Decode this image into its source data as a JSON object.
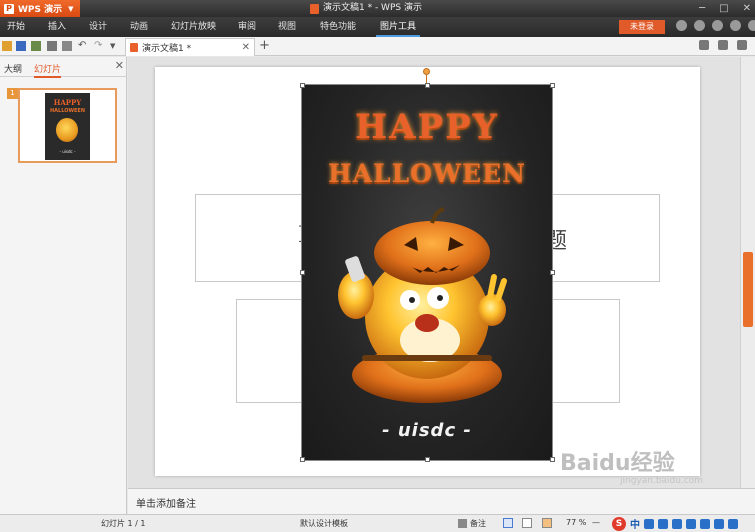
{
  "app": {
    "name": "WPS 演示",
    "window_title": "演示文稿1 * - WPS 演示",
    "window_controls": [
      "─",
      "□",
      "✕"
    ]
  },
  "menu": {
    "items": [
      {
        "label": "开始",
        "active": false
      },
      {
        "label": "插入",
        "active": false
      },
      {
        "label": "设计",
        "active": false
      },
      {
        "label": "动画",
        "active": false
      },
      {
        "label": "幻灯片放映",
        "active": false
      },
      {
        "label": "审阅",
        "active": false
      },
      {
        "label": "视图",
        "active": false
      },
      {
        "label": "特色功能",
        "active": false
      },
      {
        "label": "图片工具",
        "active": true
      }
    ],
    "login_label": "未登录",
    "icons": [
      "skin-icon",
      "help-icon",
      "tshirt-icon",
      "settings-icon",
      "expand-icon"
    ]
  },
  "toolbar": {
    "doc_tab_label": "演示文稿1 *",
    "close_tab": "✕",
    "new_tab": "+",
    "quick_icons": [
      "open-icon",
      "save-icon",
      "print-preview-icon",
      "print-icon",
      "preview-icon",
      "undo-icon",
      "redo-icon",
      "dropdown-icon"
    ]
  },
  "left_panel": {
    "tab_outline": "大纲",
    "tab_slides": "幻灯片",
    "close": "✕",
    "slide_number": "1",
    "thumb_title": "HAPPY",
    "thumb_sub": "HALLOWEEN",
    "thumb_brand": "- uisdc -"
  },
  "slide": {
    "title_ghost_left": "I",
    "title_ghost_right": "题",
    "poster_happy": "HAPPY",
    "poster_halloween": "HALLOWEEN",
    "poster_brand": "- uisdc -"
  },
  "notes": {
    "label": "单击添加备注"
  },
  "status": {
    "slide_counter": "幻灯片 1 / 1",
    "template": "默认设计模板",
    "notes_btn": "备注",
    "zoom": "77 %",
    "zoom_minus": "—"
  },
  "ime": {
    "s": "S",
    "lang": "中"
  },
  "watermark": {
    "text": "Baidu经验",
    "sub": "jingyan.baidu.com"
  },
  "colors": {
    "accent": "#e05a2a",
    "ribbon_dark": "#2c2c2c",
    "active_tab_underline": "#4a9be0"
  }
}
